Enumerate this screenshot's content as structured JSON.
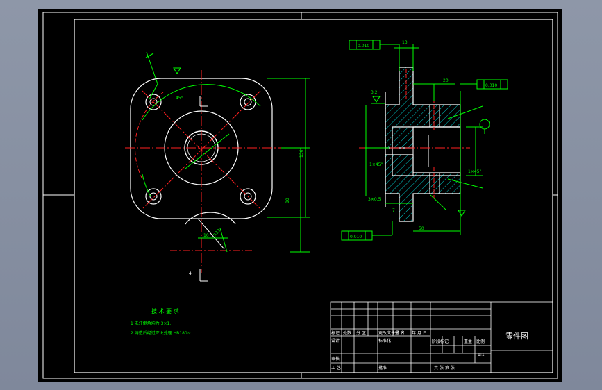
{
  "tech_req": {
    "title": "技 术 要 求",
    "items": [
      "1  未注倒角均为 3×1.",
      "2  铸造后经过正火处理 HB180~."
    ]
  },
  "title_block": {
    "drawing_name": "零件图",
    "scale": "1:1",
    "headers": [
      "标记",
      "处数",
      "分 区",
      "更改文件号",
      "签 名",
      "年.月.日"
    ],
    "design": "设计",
    "standardization": "标准化",
    "stage_mark": "阶段标记",
    "weight": "重量",
    "ratio": "比例",
    "review": "审核",
    "process": "工 艺",
    "approve": "批准",
    "sheets": "共   张  第   张"
  },
  "dimensions": {
    "d_left_vert": "136",
    "d_left_lower": "80",
    "d_dim_4": "4",
    "d_dim_10": "10",
    "d_r32": "R32",
    "d_angle": "45°",
    "d_top_13": "13",
    "d_top_20": "20",
    "d_tol_1": "0.010",
    "d_tol_2": "0.010",
    "d_tol_3": "0.010",
    "d_50": "50",
    "d_chamfer1": "1×45°",
    "d_chamfer2": "1×45°",
    "d_3x05": "3×0.5",
    "d_3_2": "3.2",
    "d_7": "7"
  },
  "colors": {
    "background": "#000000",
    "frame": "#ffffff",
    "center_line": "#ff2020",
    "dimension": "#00ff00",
    "outline": "#ffffff",
    "hatch": "#00ffff",
    "leader": "#ffff00"
  }
}
